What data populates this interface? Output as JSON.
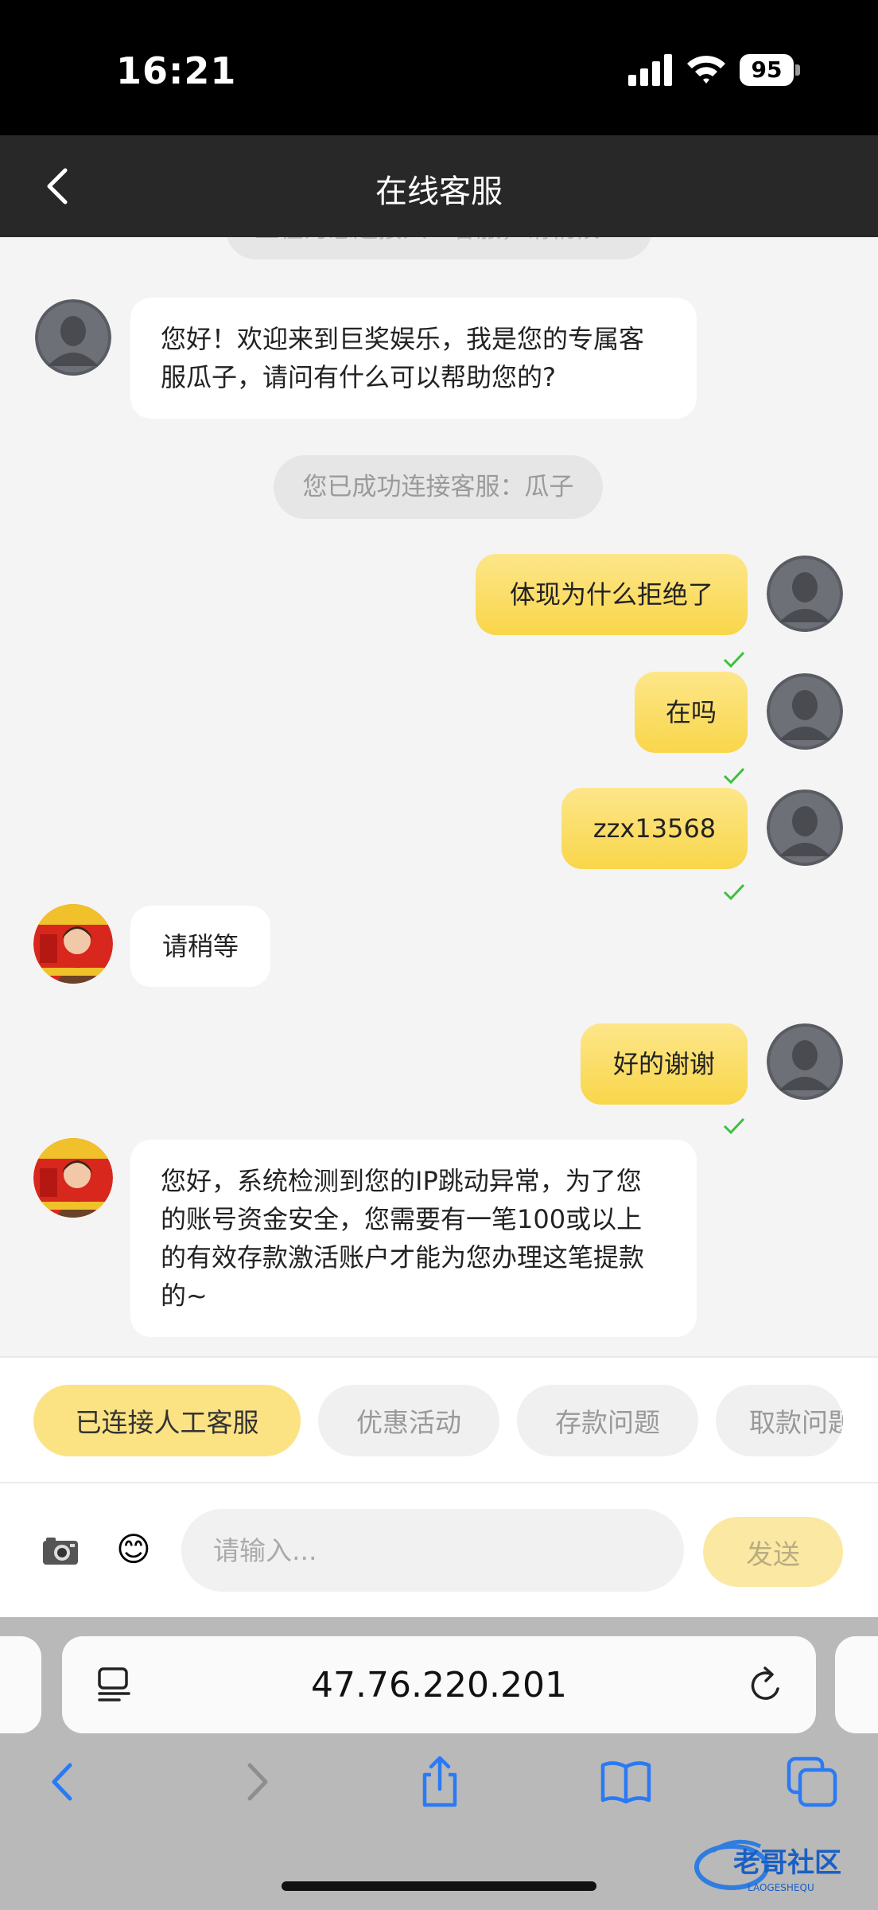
{
  "status_bar": {
    "time": "16:21",
    "battery": "95"
  },
  "header": {
    "title": "在线客服"
  },
  "chat": {
    "top_notice": "正在为您连接人工客服，请稍候...",
    "welcome_message": "您好！欢迎来到巨奖娱乐，我是您的专属客服瓜子，请问有什么可以帮助您的?",
    "connected_notice": "您已成功连接客服：瓜子",
    "messages": [
      {
        "from": "user",
        "text": "体现为什么拒绝了"
      },
      {
        "from": "user",
        "text": "在吗"
      },
      {
        "from": "user",
        "text": "zzx13568"
      },
      {
        "from": "agent",
        "text": "请稍等"
      },
      {
        "from": "user",
        "text": "好的谢谢"
      },
      {
        "from": "agent",
        "text": "您好，系统检测到您的IP跳动异常，为了您的账号资金安全，您需要有一笔100或以上的有效存款激活账户才能为您办理这笔提款的~"
      }
    ]
  },
  "quick_replies": [
    "已连接人工客服",
    "优惠活动",
    "存款问题",
    "取款问题"
  ],
  "input": {
    "placeholder": "请输入...",
    "send_label": "发送"
  },
  "browser": {
    "url": "47.76.220.201"
  },
  "watermark": {
    "text": "老哥社区",
    "sub": "LAOGESHEQU"
  },
  "colors": {
    "accent": "#f9d64a",
    "header_bg": "#282828",
    "tick": "#3cc13b"
  }
}
